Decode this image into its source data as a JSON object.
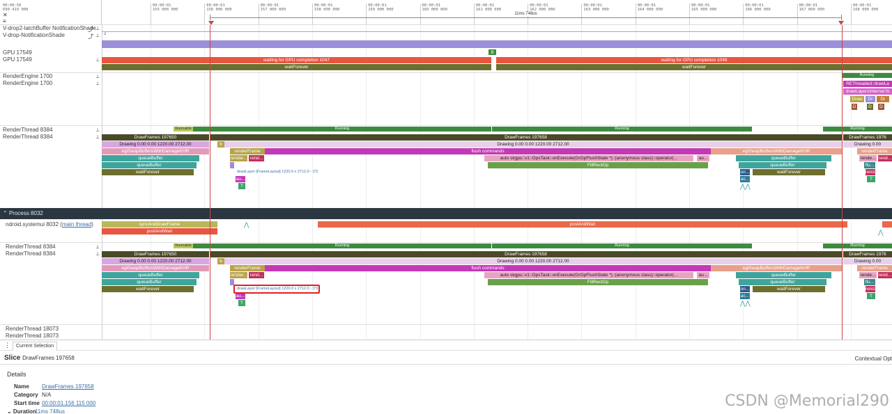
{
  "ruler": {
    "corner_lines": [
      "00:00:56",
      "690 419 000"
    ],
    "ticks": [
      {
        "t": "00:00:01",
        "v": "155 000 000"
      },
      {
        "t": "00:00:01",
        "v": "156 000 000"
      },
      {
        "t": "00:00:01",
        "v": "157 000 000"
      },
      {
        "t": "00:00:01",
        "v": "158 000 000"
      },
      {
        "t": "00:00:01",
        "v": "159 000 000"
      },
      {
        "t": "00:00:01",
        "v": "160 000 000"
      },
      {
        "t": "00:00:01",
        "v": "161 000 000"
      },
      {
        "t": "00:00:01",
        "v": "162 000 000"
      },
      {
        "t": "00:00:01",
        "v": "163 000 000"
      },
      {
        "t": "00:00:01",
        "v": "164 000 000"
      },
      {
        "t": "00:00:01",
        "v": "165 000 000"
      },
      {
        "t": "00:00:01",
        "v": "166 000 000"
      },
      {
        "t": "00:00:01",
        "v": "167 000 000"
      },
      {
        "t": "00:00:01",
        "v": "168 000 000"
      }
    ],
    "span_label": "11ms 748us"
  },
  "tracks": {
    "notif1": "V-drop2-latchBuffer NotificationShade",
    "notif2": "V-drop-NotificationShade",
    "gpu1": "GPU 17549",
    "gpu2": "GPU 17549",
    "re1": "RenderEngine 1700",
    "re2": "RenderEngine 1700",
    "rt1": "RenderThread 8384",
    "rt2": "RenderThread 8384",
    "main": "ndroid.systemui 8032",
    "main_tag": "main thread",
    "rt3": "RenderThread 8384",
    "rt4": "RenderThread 8384",
    "rt5": "RenderThread 18073",
    "rt6": "RenderThread 18073",
    "counter_val": "2"
  },
  "process": "Process 8032",
  "slices": {
    "gpu_wait_1047": "waiting for GPU completion 1047",
    "gpu_wait_1048": "waiting for GPU completion 1048",
    "wait_forever": "waitForever",
    "gpu_small": "B",
    "running": "Running",
    "runnable": "Runnable",
    "reThreaded": "REThreaded::drawLa",
    "drawLayersInternal": "drawLayersInternal fo",
    "draw_short": "Draw",
    "dr_short": "Dr",
    "d_short": "D",
    "draw_frames_1": "DrawFrames 197650",
    "draw_frames_2": "DrawFrames 197658",
    "draw_frames_3": "DrawFrames 1976",
    "drawing_1": "Drawing  0.00  0.00 1220.00 2712.00",
    "drawing_2": "Drawing  0.00  0.00 1220.00 2712.00",
    "drawing_3": "Drawing  0.00",
    "egl_swap": "eglSwapBuffersWithDamageKHR",
    "queue_buffer": "queueBuffer",
    "render_frame": "renderFrame",
    "flush_commands": "flush commands",
    "render_short": "render...",
    "rend_short": "rend...",
    "rende_short": "rende...",
    "flu_short": "flu...",
    "skgpu_task": "auto skgpu::v1::OpsTask::onExecute(GrOpFlushState *)::(anonymous class)::operator(...",
    "au_short": "au...",
    "fill_rect": "FillRectOp",
    "draw_layer": "drawLayer [FrameLayout] 1220.0 x 2712.0 - [73us]",
    "b_short": "b",
    "on_short": "on...",
    "ac_short": "ac...",
    "t_short": "T",
    "sync_draw": "syncAndDrawFrame",
    "post_wait_short": "postAndWait",
    "post_wait": "postAndWait"
  },
  "bottom": {
    "tab": "Current Selection",
    "slice_heading": "Slice",
    "slice_name": "DrawFrames 197658",
    "contextual": "Contextual Opt",
    "details": "Details",
    "rows": [
      {
        "k": "Name",
        "v": "DrawFrames 197658"
      },
      {
        "k": "Category",
        "v": "N/A"
      },
      {
        "k": "Start time",
        "v": "00:00:01.156 115 000"
      },
      {
        "k": "Duration",
        "v": "11ms 748us"
      }
    ]
  },
  "watermark": "CSDN @Memorial290",
  "colors": {
    "red": "#e9553f",
    "olive": "#6e6f2f",
    "green": "#3c8b3f",
    "teal": "#3fa59c",
    "magenta": "#c339b6",
    "pink": "#e8a3c4",
    "violet": "#9b8fd8",
    "dark": "#4a4a28"
  }
}
